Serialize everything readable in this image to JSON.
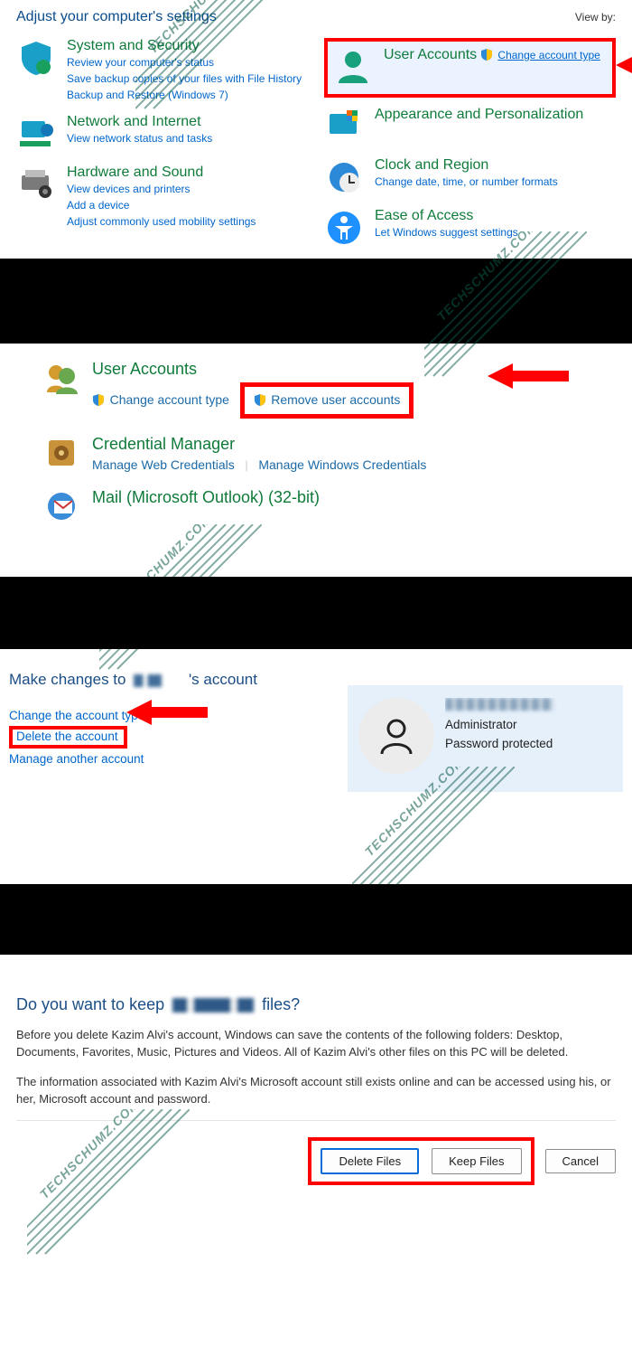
{
  "watermark": "TECHSCHUMZ.COM",
  "section1": {
    "heading": "Adjust your computer's settings",
    "viewby_label": "View by:",
    "left": [
      {
        "title": "System and Security",
        "links": [
          "Review your computer's status",
          "Save backup copies of your files with File History",
          "Backup and Restore (Windows 7)"
        ]
      },
      {
        "title": "Network and Internet",
        "links": [
          "View network status and tasks"
        ]
      },
      {
        "title": "Hardware and Sound",
        "links": [
          "View devices and printers",
          "Add a device",
          "Adjust commonly used mobility settings"
        ]
      }
    ],
    "right": [
      {
        "title": "User Accounts",
        "links": [
          "Change account type"
        ],
        "highlighted": true,
        "shield_on_link": true
      },
      {
        "title": "Appearance and Personalization",
        "links": []
      },
      {
        "title": "Clock and Region",
        "links": [
          "Change date, time, or number formats"
        ]
      },
      {
        "title": "Ease of Access",
        "links": [
          "Let Windows suggest settings"
        ]
      }
    ]
  },
  "section2": {
    "rows": [
      {
        "title": "User Accounts",
        "link1": "Change account type",
        "link2": "Remove user accounts",
        "highlight_link2": true
      },
      {
        "title": "Credential Manager",
        "link1": "Manage Web Credentials",
        "link2": "Manage Windows Credentials"
      },
      {
        "title": "Mail (Microsoft Outlook) (32-bit)"
      }
    ]
  },
  "section3": {
    "heading_prefix": "Make changes to",
    "heading_suffix": "'s account",
    "links": {
      "change_type": "Change the account type",
      "delete": "Delete the account",
      "manage_other": "Manage another account"
    },
    "card": {
      "role": "Administrator",
      "pw": "Password protected"
    }
  },
  "section4": {
    "heading_prefix": "Do you want to keep",
    "heading_suffix": "files?",
    "p1": "Before you delete Kazim Alvi's account, Windows can save the contents of the following folders: Desktop, Documents, Favorites, Music, Pictures and Videos. All of Kazim Alvi's other files on this PC will be deleted.",
    "p2": "The information associated with Kazim Alvi's Microsoft account still exists online and can be accessed using his, or her, Microsoft account and password.",
    "buttons": {
      "delete": "Delete Files",
      "keep": "Keep Files",
      "cancel": "Cancel"
    }
  }
}
